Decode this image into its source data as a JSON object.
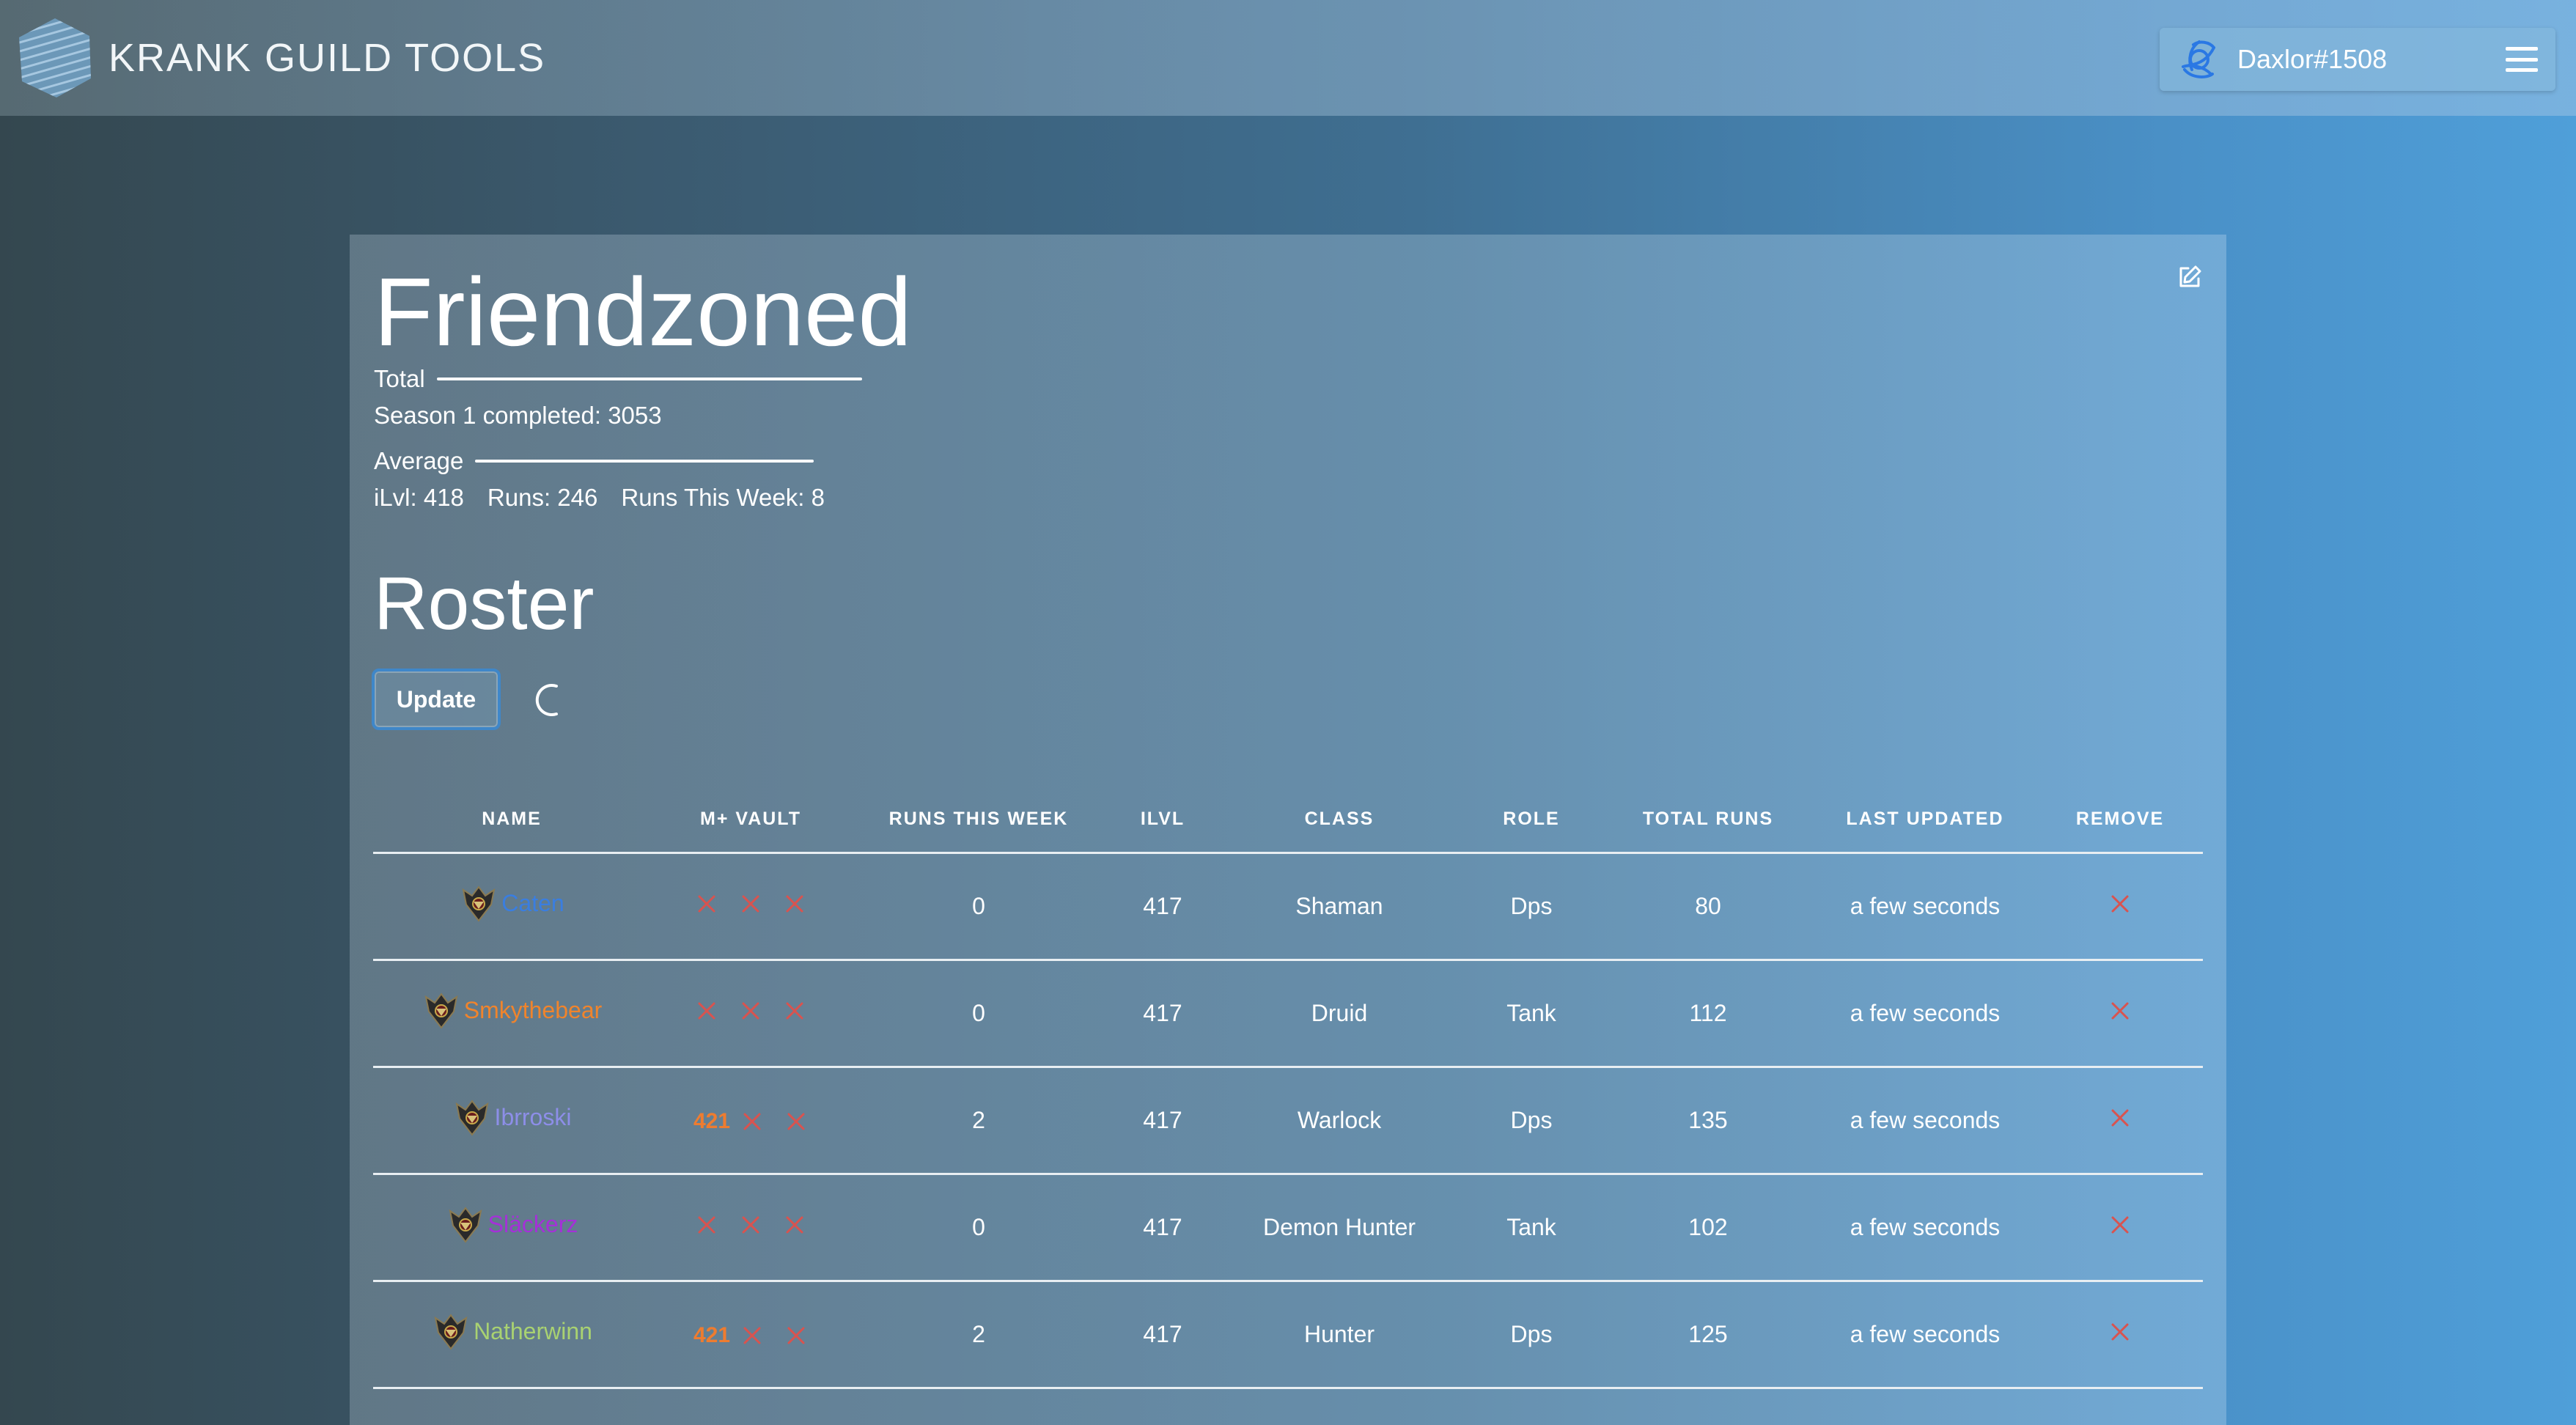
{
  "header": {
    "brand_title": "KRANK GUILD TOOLS",
    "username": "Daxlor#1508"
  },
  "guild": {
    "name": "Friendzoned",
    "total_label": "Total",
    "season_completed": "Season 1 completed: 3053",
    "average_label": "Average",
    "avg_ilvl": "iLvl: 418",
    "avg_runs": "Runs: 246",
    "avg_runs_week": "Runs This Week: 8"
  },
  "roster": {
    "title": "Roster",
    "update_label": "Update",
    "columns": [
      "NAME",
      "M+ VAULT",
      "RUNS THIS WEEK",
      "ILVL",
      "CLASS",
      "ROLE",
      "TOTAL RUNS",
      "LAST UPDATED",
      "REMOVE"
    ],
    "rows": [
      {
        "name": "Caten",
        "name_color": "#3a7ee0",
        "vault1": "",
        "runs_week": "0",
        "ilvl": "417",
        "class": "Shaman",
        "role": "Dps",
        "total_runs": "80",
        "last_updated": "a few seconds"
      },
      {
        "name": "Smkythebear",
        "name_color": "#f0842c",
        "vault1": "",
        "runs_week": "0",
        "ilvl": "417",
        "class": "Druid",
        "role": "Tank",
        "total_runs": "112",
        "last_updated": "a few seconds"
      },
      {
        "name": "Ibrroski",
        "name_color": "#8d8ee8",
        "vault1": "421",
        "runs_week": "2",
        "ilvl": "417",
        "class": "Warlock",
        "role": "Dps",
        "total_runs": "135",
        "last_updated": "a few seconds"
      },
      {
        "name": "Släckerz",
        "name_color": "#a530d8",
        "vault1": "",
        "runs_week": "0",
        "ilvl": "417",
        "class": "Demon Hunter",
        "role": "Tank",
        "total_runs": "102",
        "last_updated": "a few seconds"
      },
      {
        "name": "Natherwinn",
        "name_color": "#a9d271",
        "vault1": "421",
        "runs_week": "2",
        "ilvl": "417",
        "class": "Hunter",
        "role": "Dps",
        "total_runs": "125",
        "last_updated": "a few seconds"
      }
    ]
  },
  "colors": {
    "remove_x": "#d9534f",
    "vault_number": "#ee7c30",
    "update_border": "#3f87c9"
  },
  "icons": {
    "brand": "hexagon-logo-icon",
    "user": "battlenet-icon",
    "menu": "hamburger-menu-icon",
    "edit": "edit-icon",
    "spinner": "loading-spinner-icon",
    "vault_empty": "close-icon",
    "remove": "close-icon"
  }
}
